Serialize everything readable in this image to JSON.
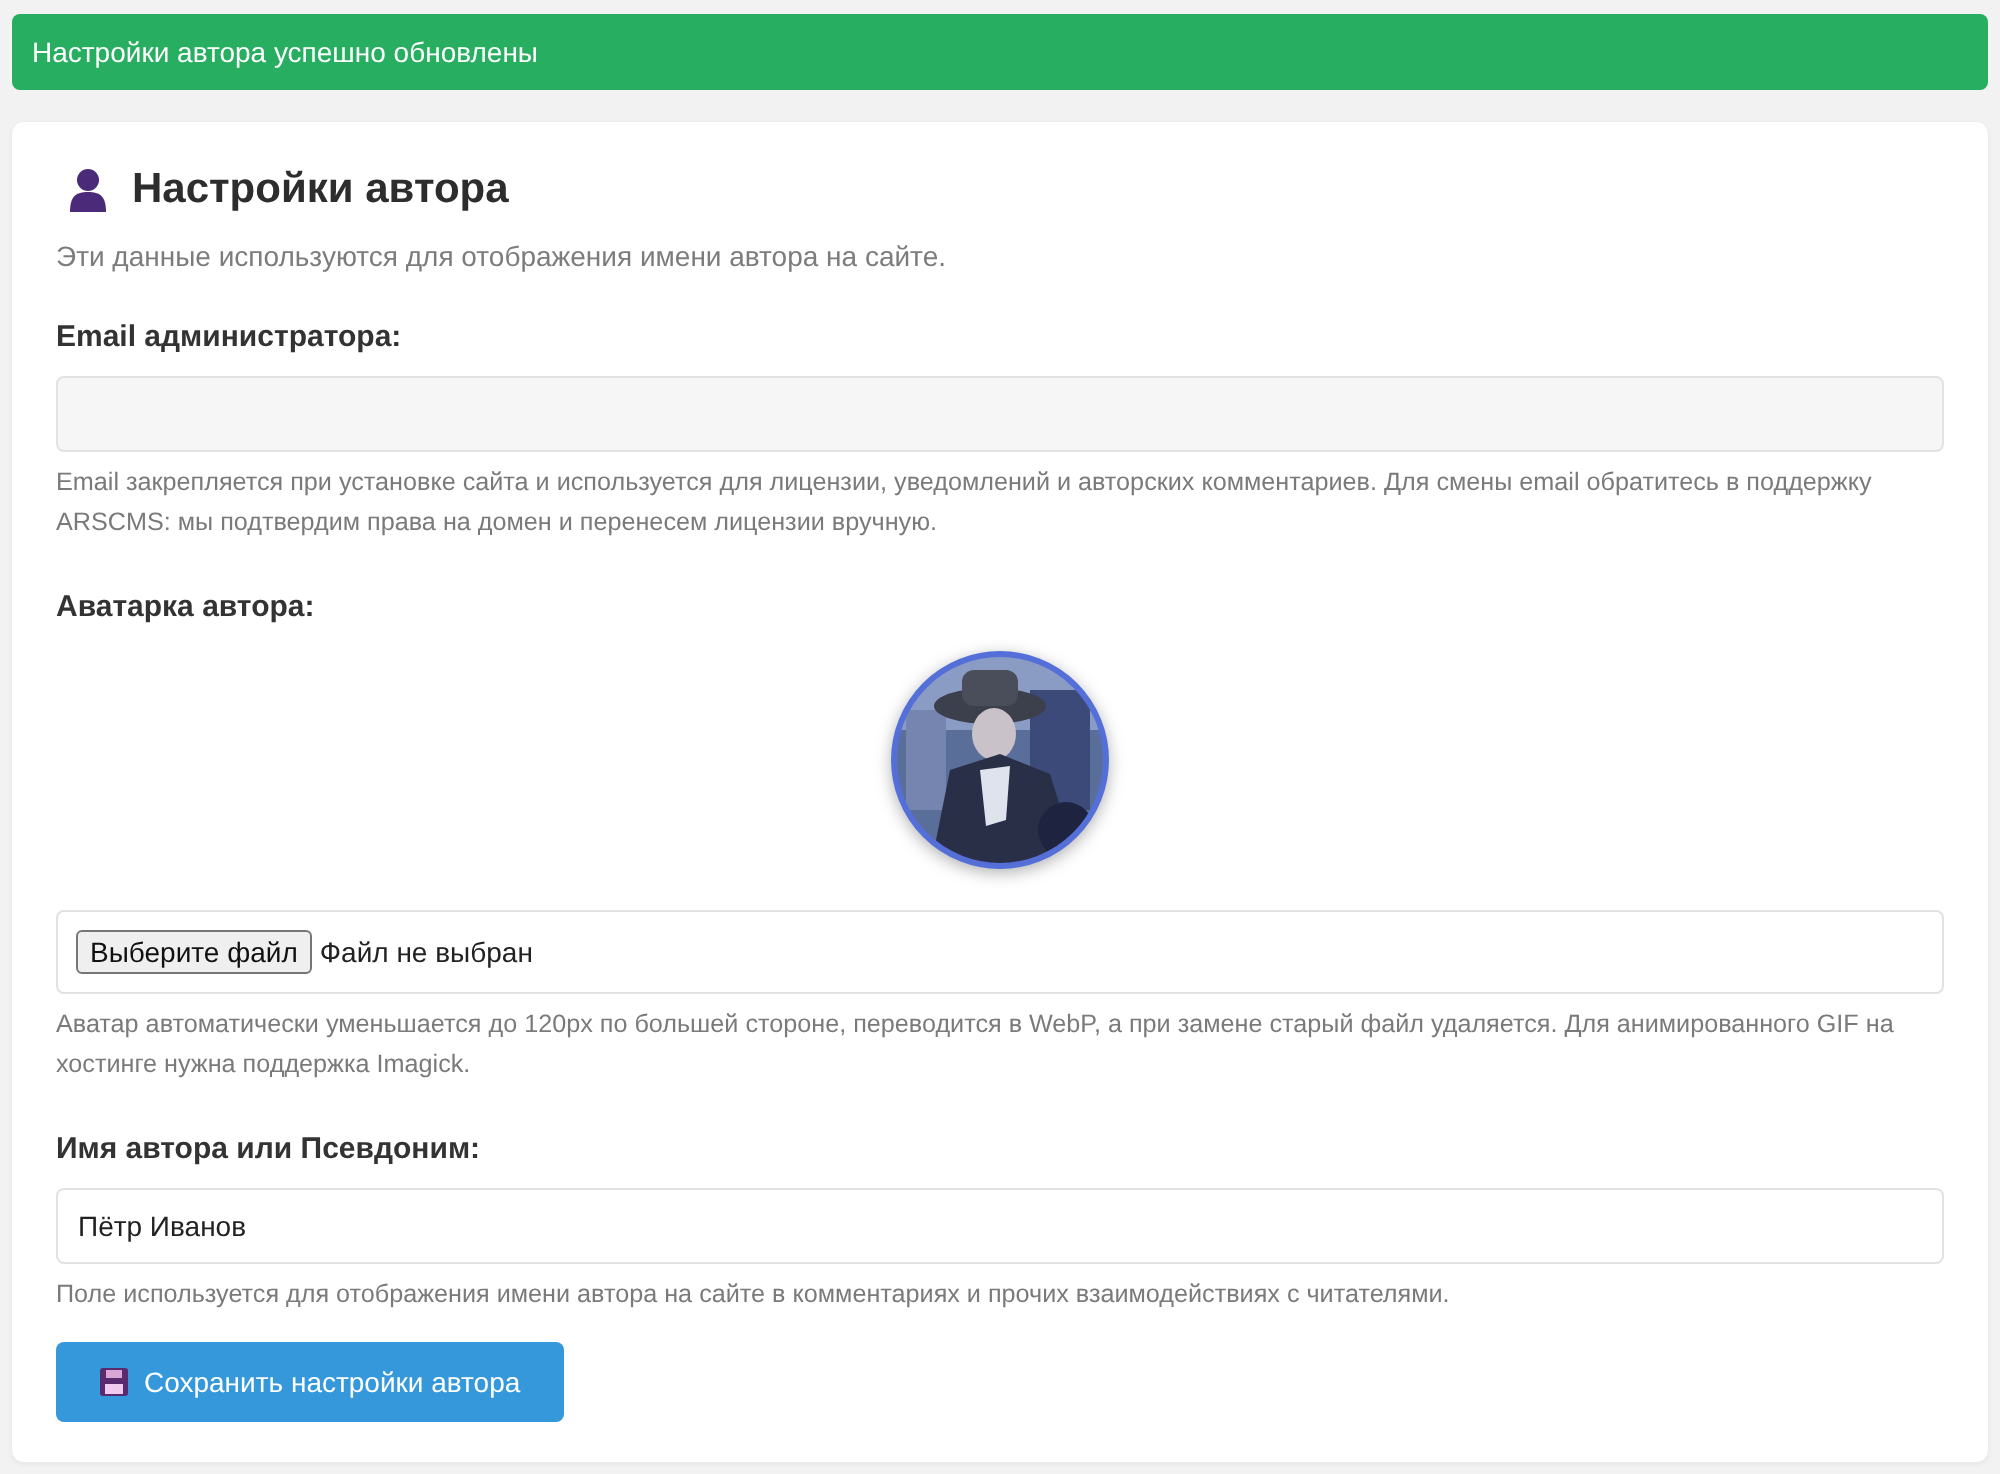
{
  "alert": {
    "text": "Настройки автора успешно обновлены"
  },
  "card": {
    "title": "Настройки автора",
    "subtitle": "Эти данные используются для отображения имени автора на сайте.",
    "email": {
      "label": "Email администратора:",
      "help": "Email закрепляется при установке сайта и используется для лицензии, уведомлений и авторских комментариев. Для смены email обратитесь в поддержку ARSCMS: мы подтвердим права на домен и перенесем лицензии вручную."
    },
    "avatar": {
      "label": "Аватарка автора:",
      "file_button": "Выберите файл",
      "file_status": "Файл не выбран",
      "help": "Аватар автоматически уменьшается до 120px по большей стороне, переводится в WebP, а при замене старый файл удаляется. Для анимированного GIF на хостинге нужна поддержка Imagick."
    },
    "name": {
      "label": "Имя автора или Псевдоним:",
      "value": "Пётр Иванов",
      "help": "Поле используется для отображения имени автора на сайте в комментариях и прочих взаимодействиях с читателями."
    },
    "save_button": "Сохранить настройки автора"
  }
}
